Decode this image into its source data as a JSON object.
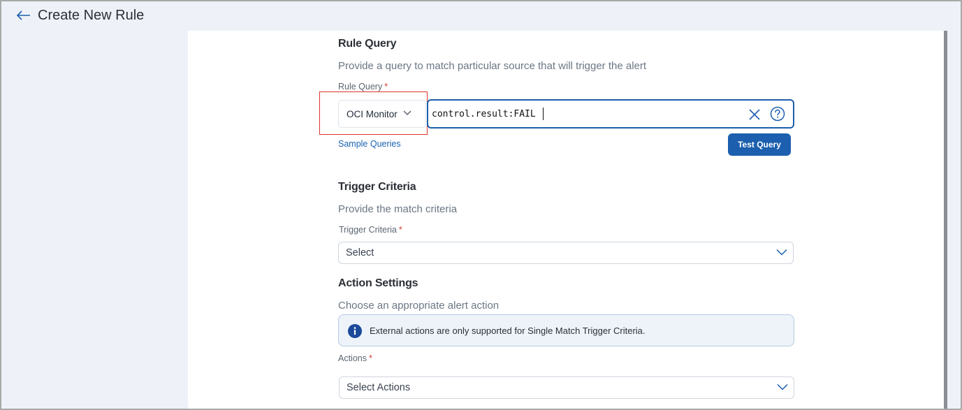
{
  "header": {
    "title": "Create New Rule"
  },
  "rule_query": {
    "title": "Rule Query",
    "description": "Provide a query to match particular source that will trigger the alert",
    "field_label": "Rule Query",
    "required_mark": "*",
    "source_value": "OCI Monitor",
    "query_value": "control.result:FAIL",
    "sample_link": "Sample Queries",
    "test_button": "Test Query"
  },
  "trigger_criteria": {
    "title": "Trigger Criteria",
    "description": "Provide the match criteria",
    "field_label": "Trigger Criteria",
    "required_mark": "*",
    "select_value": "Select"
  },
  "action_settings": {
    "title": "Action Settings",
    "description": "Choose an appropriate alert action",
    "info_text": "External actions are only supported for Single Match Trigger Criteria.",
    "field_label": "Actions",
    "required_mark": "*",
    "select_value": "Select Actions"
  },
  "colors": {
    "primary": "#1b5fae",
    "highlight": "#d9342b",
    "required": "#d23c2d",
    "background": "#eef2f8"
  },
  "icons": {
    "back": "arrow-left-icon",
    "chevron": "chevron-down-icon",
    "clear": "close-icon",
    "help": "question-circle-icon",
    "info": "info-circle-icon"
  }
}
